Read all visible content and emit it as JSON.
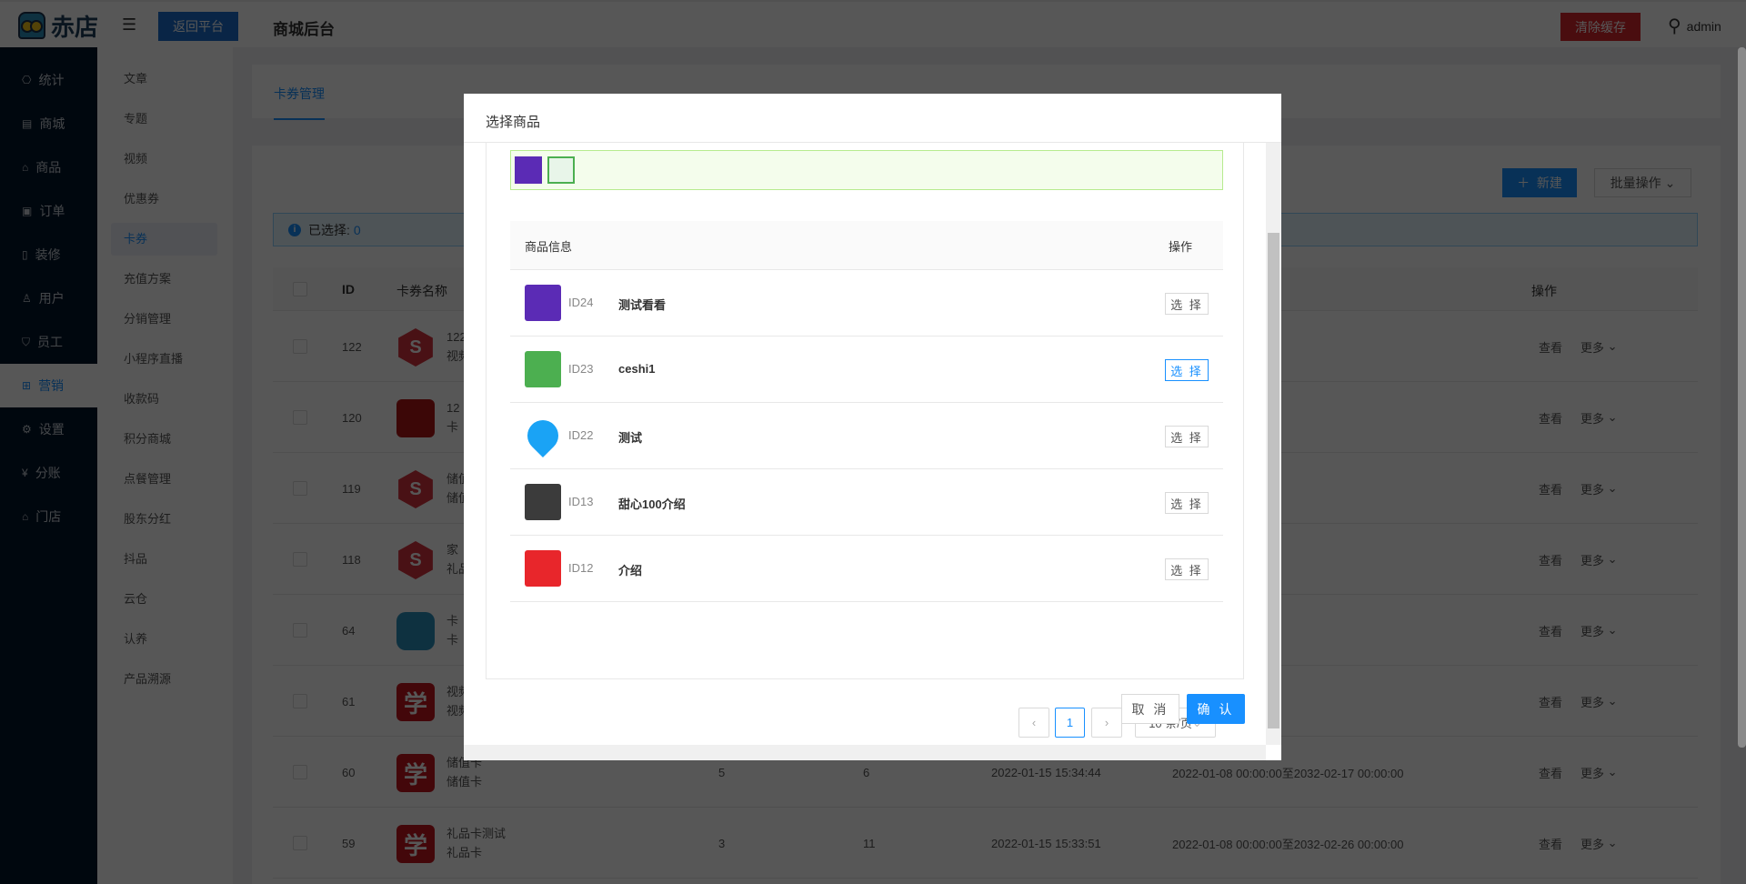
{
  "header": {
    "logo_text": "赤店",
    "back_label": "返回平台",
    "title": "商城后台",
    "clear_cache_label": "清除缓存",
    "user": "admin"
  },
  "sidebar": {
    "items": [
      {
        "label": "统计",
        "icon": "dashboard-icon"
      },
      {
        "label": "商城",
        "icon": "store-icon"
      },
      {
        "label": "商品",
        "icon": "bag-icon"
      },
      {
        "label": "订单",
        "icon": "order-icon"
      },
      {
        "label": "装修",
        "icon": "tablet-icon"
      },
      {
        "label": "用户",
        "icon": "user-icon"
      },
      {
        "label": "员工",
        "icon": "shield-icon"
      },
      {
        "label": "营销",
        "icon": "network-icon",
        "active": true
      },
      {
        "label": "设置",
        "icon": "gear-icon"
      },
      {
        "label": "分账",
        "icon": "yen-icon"
      },
      {
        "label": "门店",
        "icon": "shop-icon"
      }
    ]
  },
  "submenu": {
    "items": [
      "文章",
      "专题",
      "视频",
      "优惠券",
      "卡券",
      "充值方案",
      "分销管理",
      "小程序直播",
      "收款码",
      "积分商城",
      "点餐管理",
      "股东分红",
      "抖品",
      "云仓",
      "认养",
      "产品溯源"
    ],
    "active": "卡券"
  },
  "main": {
    "tab": "卡券管理",
    "new_label": "新建",
    "batch_label": "批量操作",
    "selected_label": "已选择:",
    "selected_count": "0",
    "columns": {
      "id": "ID",
      "name": "卡券名称",
      "actions": "操作"
    },
    "view_label": "查看",
    "more_label": "更多",
    "rows": [
      {
        "id": "122",
        "name": "122",
        "type": "视频",
        "thumb": "hex"
      },
      {
        "id": "120",
        "name": "12",
        "type": "卡",
        "thumb": "red"
      },
      {
        "id": "119",
        "name": "储值",
        "type": "储值",
        "thumb": "hex"
      },
      {
        "id": "118",
        "name": "家",
        "type": "礼品",
        "thumb": "hex"
      },
      {
        "id": "64",
        "name": "卡",
        "type": "卡",
        "thumb": "owl"
      },
      {
        "id": "61",
        "name": "视频",
        "type": "视频",
        "thumb": "xue"
      },
      {
        "id": "60",
        "name": "储值卡",
        "type": "储值卡",
        "thumb": "xue",
        "c1": "5",
        "c2": "6",
        "created": "2022-01-15 15:34:44",
        "range": "2022-01-08 00:00:00至2032-02-17 00:00:00"
      },
      {
        "id": "59",
        "name": "礼品卡测试",
        "type": "礼品卡",
        "thumb": "xue",
        "c1": "3",
        "c2": "11",
        "created": "2022-01-15 15:33:51",
        "range": "2022-01-08 00:00:00至2032-02-26 00:00:00"
      }
    ]
  },
  "modal": {
    "title": "选择商品",
    "columns": {
      "info": "商品信息",
      "action": "操作"
    },
    "select_label": "选 择",
    "products": [
      {
        "id": "ID24",
        "name": "测试看看",
        "color": "#5b2bb5"
      },
      {
        "id": "ID23",
        "name": "ceshi1",
        "color": "#4caf50"
      },
      {
        "id": "ID22",
        "name": "测试",
        "color": "#1aa3f5"
      },
      {
        "id": "ID13",
        "name": "甜心100介绍",
        "color": "#3b3b3b"
      },
      {
        "id": "ID12",
        "name": "介绍",
        "color": "#e8262b"
      }
    ],
    "pagination": {
      "prev": "‹",
      "current": "1",
      "next": "›",
      "page_size": "10 条/页"
    },
    "cancel_label": "取 消",
    "confirm_label": "确 认"
  },
  "colors": {
    "primary": "#1890ff",
    "sidebar": "#001529",
    "danger": "#d9262c"
  }
}
